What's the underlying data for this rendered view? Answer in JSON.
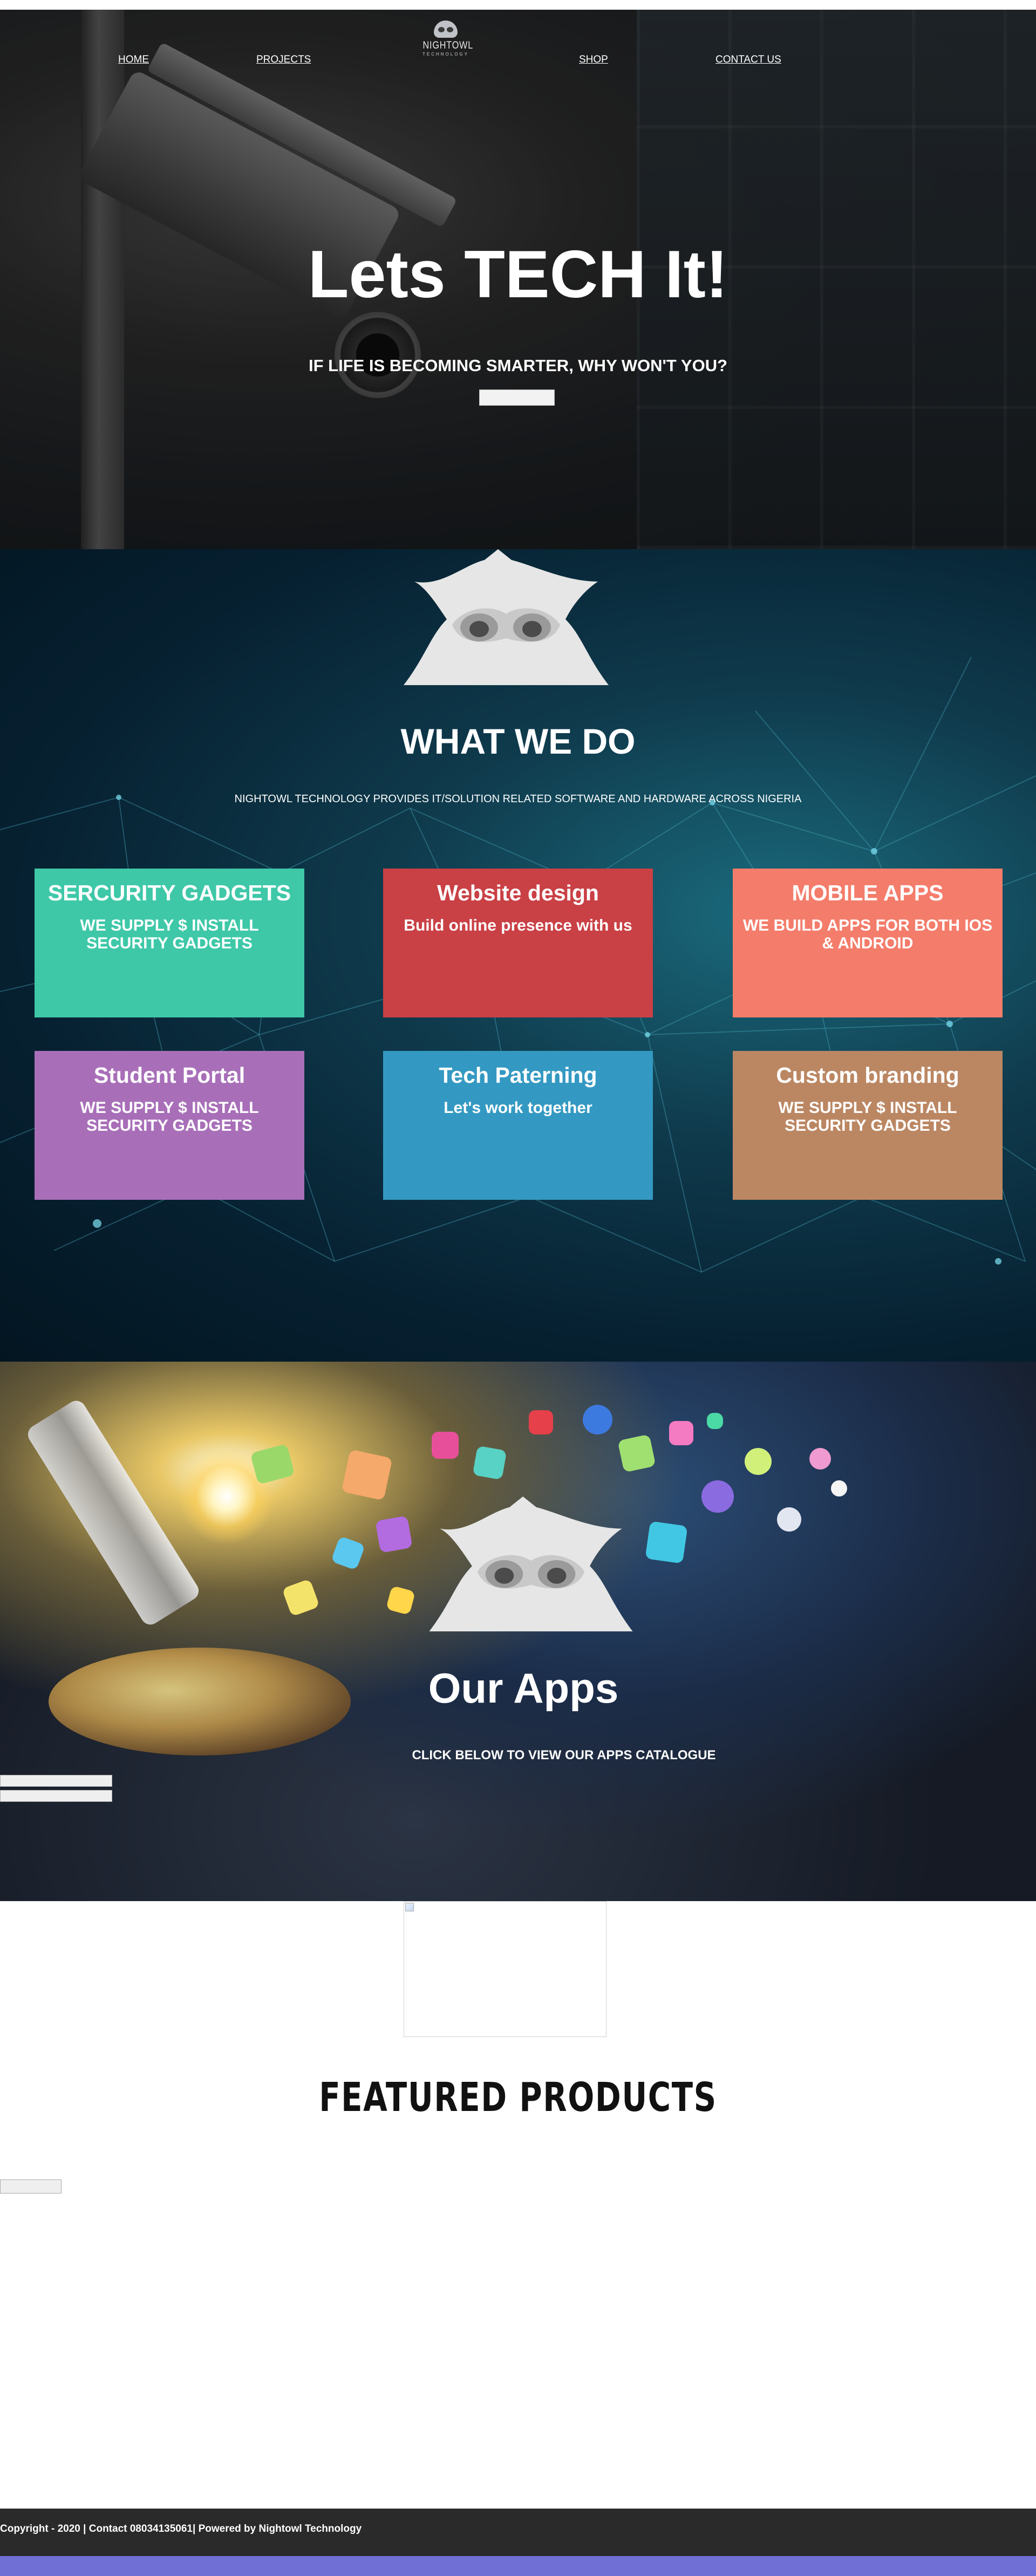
{
  "nav": {
    "items": [
      {
        "label": "HOME"
      },
      {
        "label": "PROJECTS"
      },
      {
        "label": "SHOP"
      },
      {
        "label": "CONTACT US"
      }
    ],
    "logo": {
      "brand": "NIGHTOWL",
      "tagline": "TECHNOLOGY"
    }
  },
  "hero": {
    "title": "Lets TECH It!",
    "subtitle": "IF LIFE IS BECOMING SMARTER, WHY WON'T YOU?",
    "button_label": ""
  },
  "what_we_do": {
    "title": "WHAT WE DO",
    "subtitle": "NIGHTOWL TECHNOLOGY PROVIDES IT/SOLUTION RELATED SOFTWARE AND HARDWARE ACROSS NIGERIA",
    "cards": [
      {
        "title": "SERCURITY GADGETS",
        "text": "WE SUPPLY $ INSTALL SECURITY GADGETS",
        "color": "#3ec8a8"
      },
      {
        "title": "Website design",
        "text": "Build online presence with us",
        "color": "#c94045"
      },
      {
        "title": "MOBILE APPS",
        "text": "WE BUILD APPS FOR BOTH IOS & ANDROID",
        "color": "#f47c6a"
      },
      {
        "title": "Student Portal",
        "text": "WE SUPPLY $ INSTALL SECURITY GADGETS",
        "color": "#a86fb8"
      },
      {
        "title": "Tech Paterning",
        "text": "Let's work together",
        "color": "#3499c2"
      },
      {
        "title": "Custom branding",
        "text": "WE SUPPLY $ INSTALL SECURITY GADGETS",
        "color": "#bb8763"
      }
    ]
  },
  "apps": {
    "title": "Our Apps",
    "subtitle": "CLICK BELOW TO VIEW OUR APPS CATALOGUE",
    "button_labels": [
      "",
      ""
    ]
  },
  "featured": {
    "title": "FEATURED PRODUCTS",
    "button_label": ""
  },
  "footer": {
    "text": "Copyright - 2020 | Contact 08034135061| Powered by Nightowl Technology"
  },
  "colors": {
    "footer_bg": "#2a2a2a",
    "bottom_bar": "#6f6fd6"
  }
}
